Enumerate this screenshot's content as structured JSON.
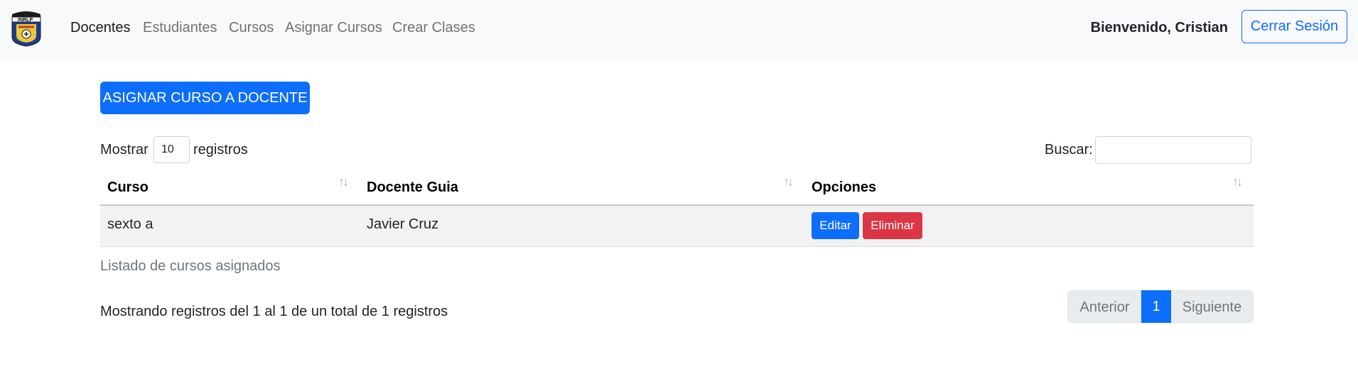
{
  "navbar": {
    "logo_text": "INRLP",
    "links": [
      "Docentes",
      "Estudiantes",
      "Cursos",
      "Asignar Cursos",
      "Crear Clases"
    ],
    "welcome": "Bienvenido, Cristian",
    "logout_label": "Cerrar Sesión"
  },
  "main": {
    "assign_button": "ASIGNAR CURSO A DOCENTE",
    "length": {
      "prefix": "Mostrar",
      "value": "10",
      "suffix": "registros"
    },
    "search": {
      "label": "Buscar:",
      "value": ""
    },
    "table": {
      "headers": [
        "Curso",
        "Docente Guia",
        "Opciones"
      ],
      "rows": [
        {
          "curso": "sexto a",
          "docente": "Javier Cruz",
          "edit_label": "Editar",
          "delete_label": "Eliminar"
        }
      ]
    },
    "caption": "Listado de cursos asignados",
    "info": "Mostrando registros del 1 al 1 de un total de 1 registros",
    "pagination": {
      "prev": "Anterior",
      "current": "1",
      "next": "Siguiente"
    }
  },
  "colors": {
    "primary": "#0d6efd",
    "danger": "#dc3545",
    "navbar_bg": "#f8f9fa"
  },
  "icons": {
    "logo": "school-crest-logo",
    "sort": "sort-arrows-icon"
  }
}
